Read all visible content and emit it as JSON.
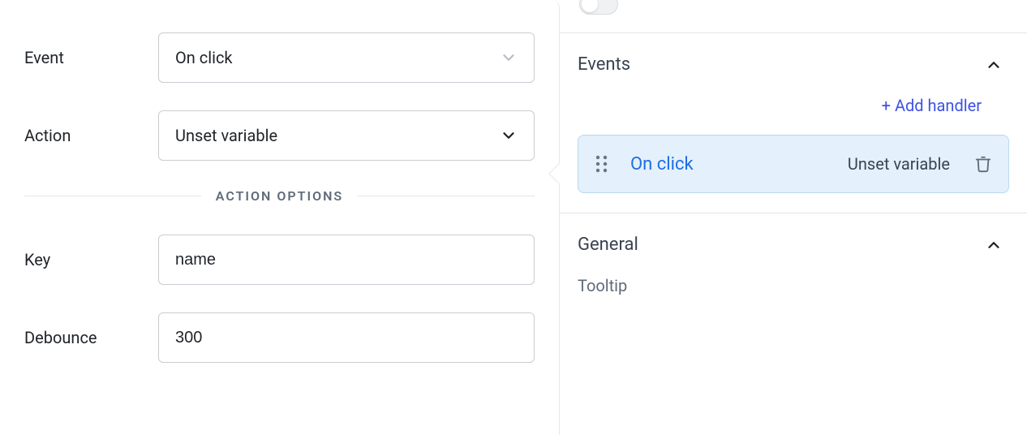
{
  "form": {
    "event_label": "Event",
    "event_value": "On click",
    "action_label": "Action",
    "action_value": "Unset variable",
    "section_divider": "ACTION OPTIONS",
    "key_label": "Key",
    "key_value": "name",
    "debounce_label": "Debounce",
    "debounce_value": "300"
  },
  "sidebar": {
    "events_title": "Events",
    "add_handler": "+ Add handler",
    "handler": {
      "event": "On click",
      "action": "Unset variable"
    },
    "general_title": "General",
    "tooltip_label": "Tooltip"
  }
}
